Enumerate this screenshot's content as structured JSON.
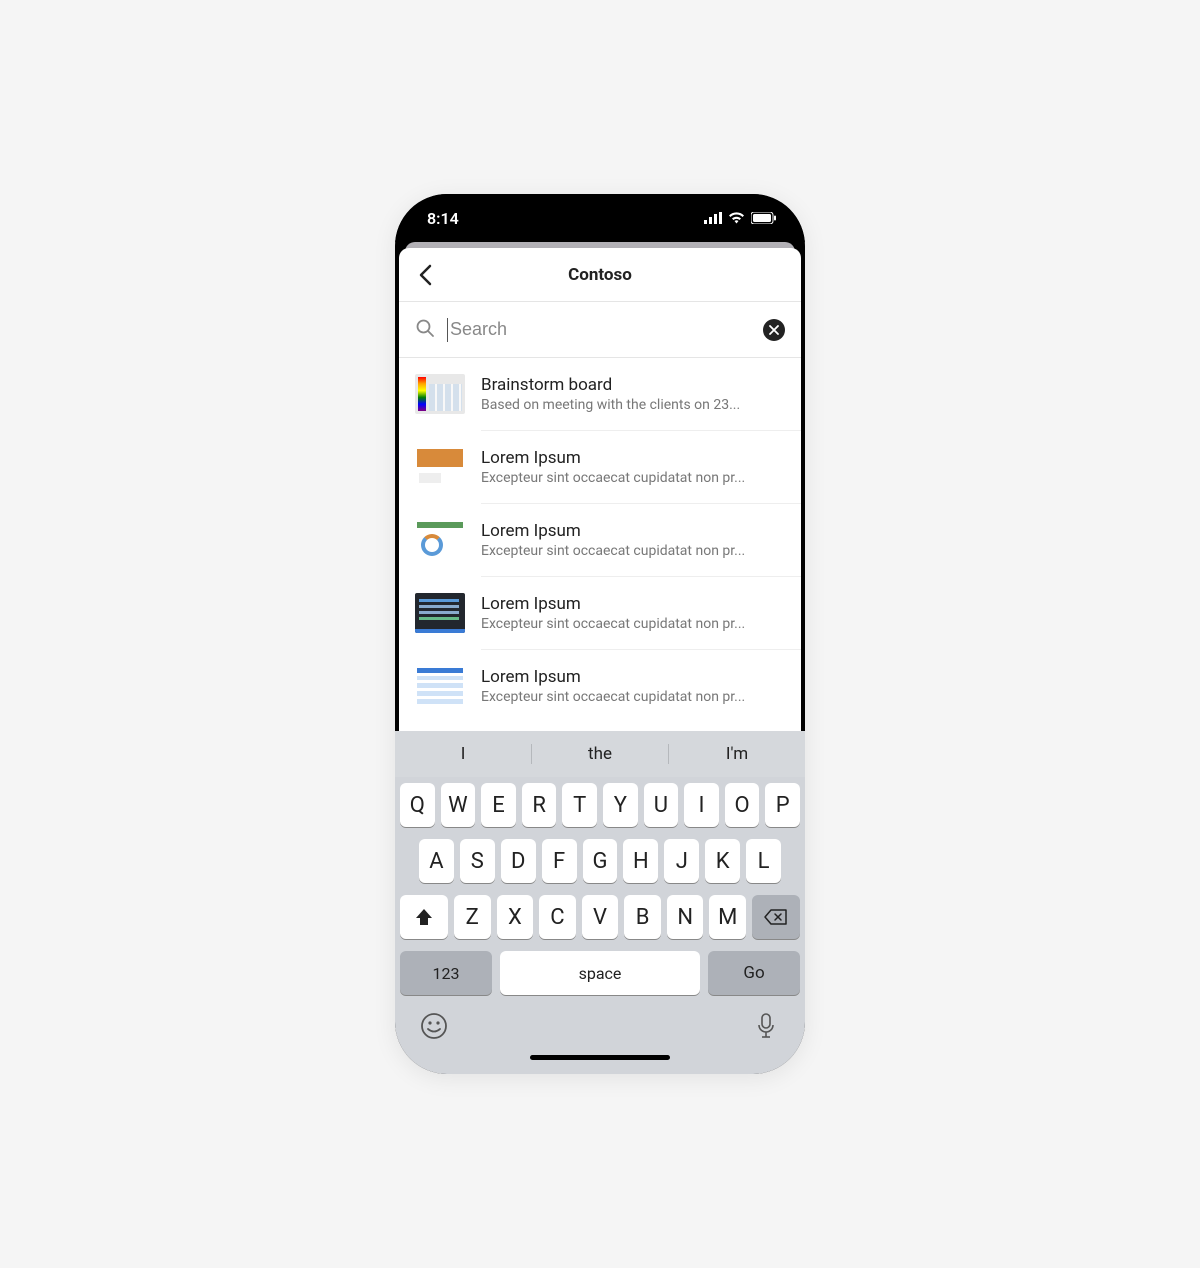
{
  "statusbar": {
    "time": "8:14"
  },
  "nav": {
    "title": "Contoso"
  },
  "search": {
    "placeholder": "Search",
    "value": ""
  },
  "results": [
    {
      "title": "Brainstorm board",
      "subtitle": "Based on meeting with the clients on 23...",
      "thumb": "rainbow"
    },
    {
      "title": "Lorem Ipsum",
      "subtitle": "Excepteur sint occaecat cupidatat non pr...",
      "thumb": "orange"
    },
    {
      "title": "Lorem Ipsum",
      "subtitle": "Excepteur sint occaecat cupidatat non pr...",
      "thumb": "chart"
    },
    {
      "title": "Lorem Ipsum",
      "subtitle": "Excepteur sint occaecat cupidatat non pr...",
      "thumb": "code"
    },
    {
      "title": "Lorem Ipsum",
      "subtitle": "Excepteur sint occaecat cupidatat non pr...",
      "thumb": "table"
    }
  ],
  "keyboard": {
    "predictions": [
      "I",
      "the",
      "I'm"
    ],
    "row1": [
      "Q",
      "W",
      "E",
      "R",
      "T",
      "Y",
      "U",
      "I",
      "O",
      "P"
    ],
    "row2": [
      "A",
      "S",
      "D",
      "F",
      "G",
      "H",
      "J",
      "K",
      "L"
    ],
    "row3": [
      "Z",
      "X",
      "C",
      "V",
      "B",
      "N",
      "M"
    ],
    "k123": "123",
    "space": "space",
    "go": "Go"
  }
}
